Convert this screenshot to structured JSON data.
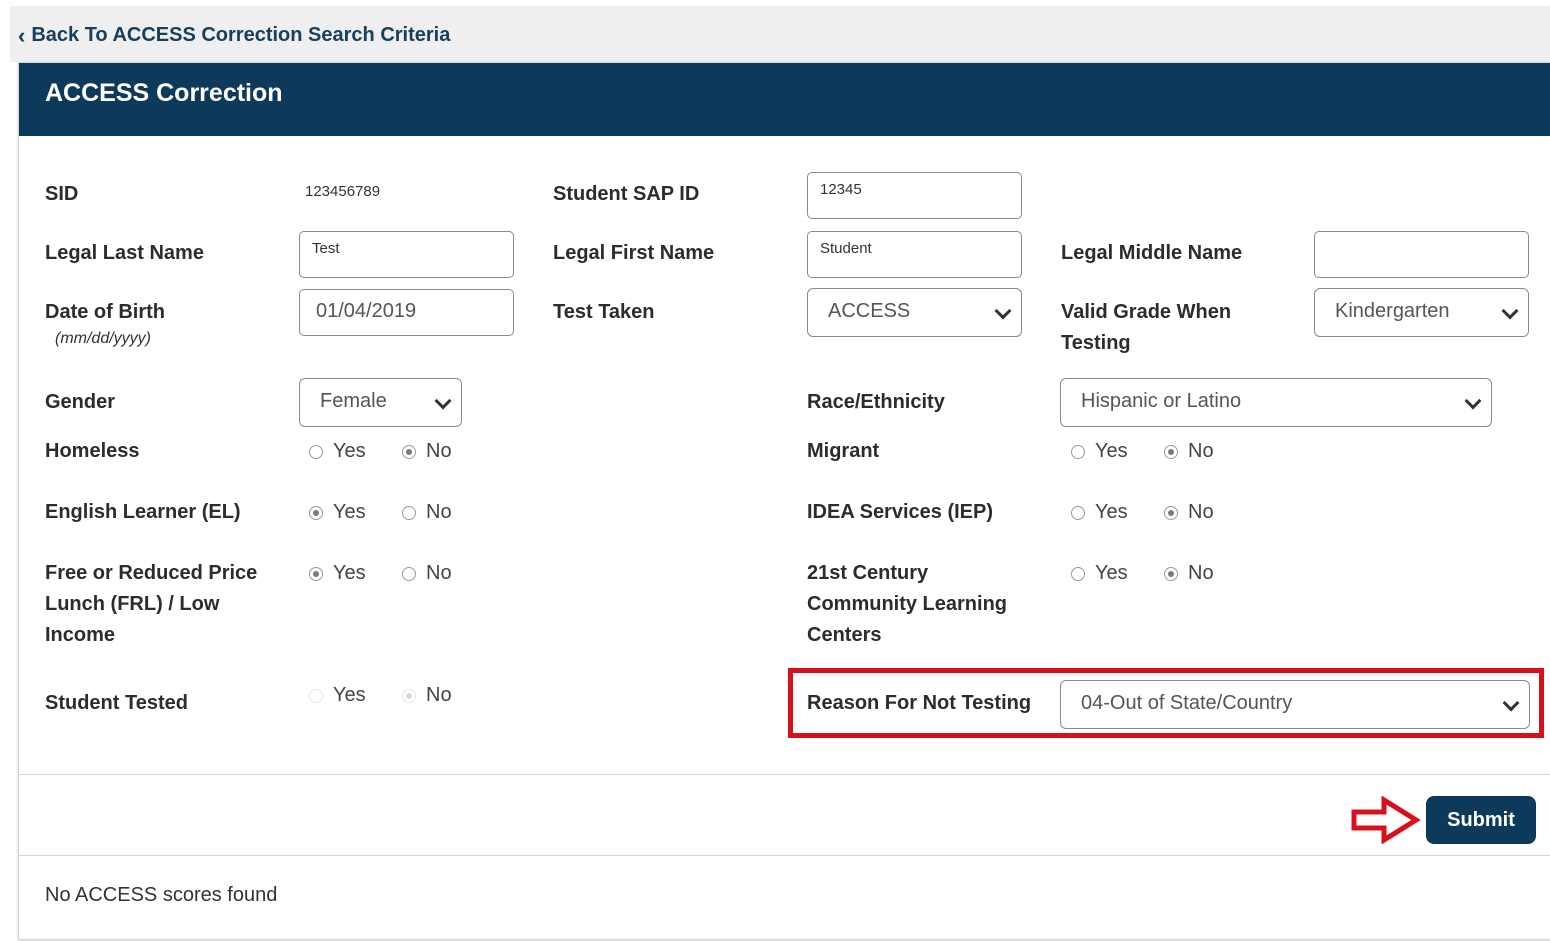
{
  "back_link": "Back To ACCESS Correction Search Criteria",
  "header": {
    "title": "ACCESS Correction"
  },
  "fields": {
    "sid": {
      "label": "SID",
      "value": "123456789"
    },
    "sap_id": {
      "label": "Student SAP ID",
      "value": "12345"
    },
    "last_name": {
      "label": "Legal Last Name",
      "value": "Test"
    },
    "first_name": {
      "label": "Legal First Name",
      "value": "Student"
    },
    "middle_name": {
      "label": "Legal Middle Name",
      "value": ""
    },
    "dob": {
      "label": "Date of Birth",
      "hint": "(mm/dd/yyyy)",
      "value": "01/04/2019"
    },
    "test_taken": {
      "label": "Test Taken",
      "value": "ACCESS"
    },
    "grade": {
      "label1": "Valid Grade When",
      "label2": "Testing",
      "value": "Kindergarten"
    },
    "gender": {
      "label": "Gender",
      "value": "Female"
    },
    "race": {
      "label": "Race/Ethnicity",
      "value": "Hispanic or Latino"
    },
    "reason": {
      "label": "Reason For Not Testing",
      "value": "04-Out of State/Country"
    }
  },
  "radio_labels": {
    "yes": "Yes",
    "no": "No"
  },
  "radios": {
    "homeless": {
      "label": "Homeless",
      "selected": "No"
    },
    "migrant": {
      "label": "Migrant",
      "selected": "No"
    },
    "el": {
      "label": "English Learner (EL)",
      "selected": "Yes"
    },
    "iep": {
      "label": "IDEA Services (IEP)",
      "selected": "No"
    },
    "frl": {
      "label1": "Free or Reduced Price",
      "label2": "Lunch (FRL) / Low",
      "label3": "Income",
      "selected": "Yes"
    },
    "c21": {
      "label1": "21st Century",
      "label2": "Community Learning",
      "label3": "Centers",
      "selected": "No"
    },
    "tested": {
      "label": "Student Tested",
      "selected": "No",
      "disabled": true
    }
  },
  "submit_label": "Submit",
  "no_scores": "No ACCESS scores found",
  "colors": {
    "header": "#0d3a5a",
    "highlight": "#d8101c",
    "back_link": "#16405d"
  }
}
